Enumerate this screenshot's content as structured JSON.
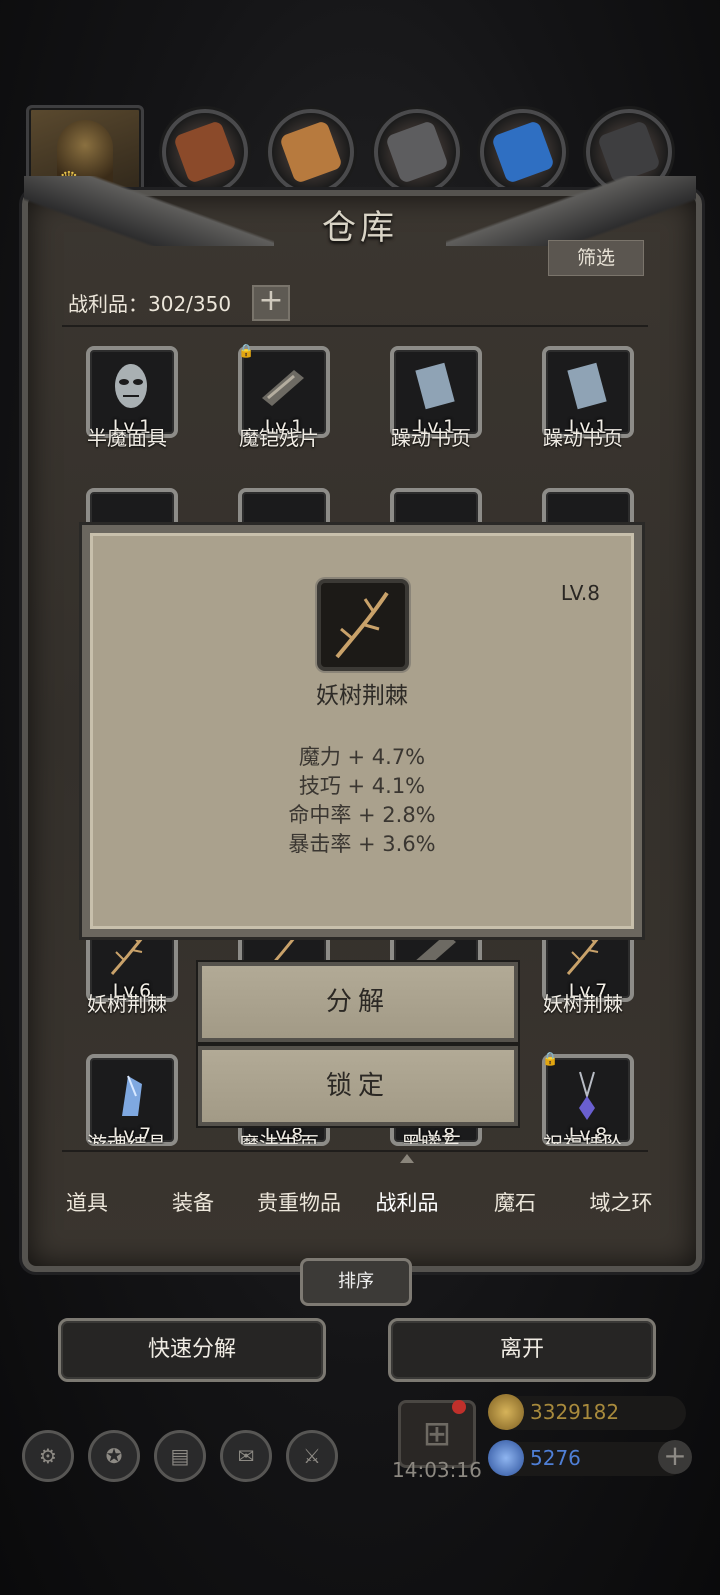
{
  "resources": [
    {
      "name": "wood-resource",
      "value": "",
      "color": "#a0522d"
    },
    {
      "name": "plank-resource",
      "value": "",
      "color": "#c88a4a"
    },
    {
      "name": "iron-resource",
      "value": "",
      "color": "#6b6b6b"
    },
    {
      "name": "crystal-resource",
      "value": "",
      "color": "#3a7fd0"
    },
    {
      "name": "coal-resource",
      "value": "",
      "color": "#4a4a4a"
    }
  ],
  "panel": {
    "title": "仓库",
    "filter_label": "筛选",
    "loot_count": "战利品：302/350",
    "add_label": "+"
  },
  "items_row1": [
    {
      "lv": "Lv.1",
      "name": "半魔面具",
      "icon": "mask-icon",
      "locked": false
    },
    {
      "lv": "Lv.1",
      "name": "魔铠残片",
      "icon": "armor-shard-icon",
      "locked": true
    },
    {
      "lv": "Lv.1",
      "name": "躁动书页",
      "icon": "book-page-icon",
      "locked": false
    },
    {
      "lv": "Lv.1",
      "name": "躁动书页",
      "icon": "book-page-icon",
      "locked": false
    }
  ],
  "items_row4": [
    {
      "lv": "Lv.6",
      "name": "妖树荆棘"
    },
    {
      "lv": "",
      "name": ""
    },
    {
      "lv": "",
      "name": ""
    },
    {
      "lv": "Lv.7",
      "name": "妖树荆棘"
    }
  ],
  "items_row5": [
    {
      "lv": "Lv.7",
      "name": "游魂结晶"
    },
    {
      "lv": "Lv.8",
      "name": "魔法书页"
    },
    {
      "lv": "Lv.8",
      "name": "黑曜石"
    },
    {
      "lv": "Lv.8",
      "name": "祝福挂坠"
    }
  ],
  "tooltip": {
    "level": "LV.8",
    "name": "妖树荆棘",
    "stats": [
      "魔力 + 4.7%",
      "技巧 + 4.1%",
      "命中率 + 2.8%",
      "暴击率 + 3.6%"
    ]
  },
  "actions": {
    "decompose": "分解",
    "lock": "锁定"
  },
  "tabs": [
    "道具",
    "装备",
    "贵重物品",
    "战利品",
    "魔石",
    "域之环"
  ],
  "active_tab_index": 3,
  "sort_label": "排序",
  "quick_decompose": "快速分解",
  "leave": "离开",
  "clock": "14:03:16",
  "gold": "3329182",
  "gems": "5276",
  "colors": {
    "gold": "#a88a3c",
    "gem": "#4f7fd6",
    "panel": "#3b3630"
  }
}
